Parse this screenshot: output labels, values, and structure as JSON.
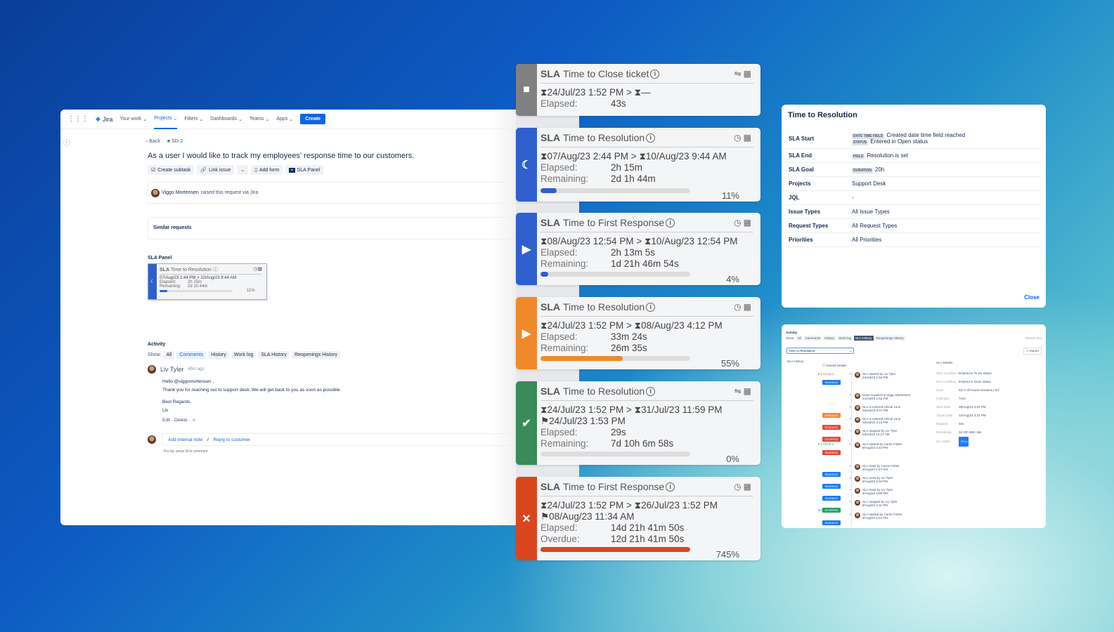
{
  "jira": {
    "nav": {
      "logo": "Jira",
      "items": [
        "Your work",
        "Projects",
        "Filters",
        "Dashboards",
        "Teams",
        "Apps"
      ],
      "active": "Projects",
      "create": "Create"
    },
    "back": "Back",
    "issue_key": "SD-2",
    "title": "As a user I would like to track my employees' response time to our customers.",
    "actions": {
      "subtask": "Create subtask",
      "link": "Link issue",
      "form": "Add form",
      "sla": "SLA Panel"
    },
    "raised": {
      "name": "Viggo Mortensen",
      "text": "raised this request via Jira"
    },
    "similar": "Similar requests",
    "sla_panel": {
      "label": "SLA Panel",
      "sla": "SLA",
      "name": "Time to Resolution",
      "dates": "07/Aug/23 2:44 PM > 10/Aug/23 9:44 AM",
      "elapsed_label": "Elapsed:",
      "elapsed": "2h 15m",
      "remaining_label": "Remaining:",
      "remaining": "2d 1h 44m",
      "percent": "11%",
      "progress": 11
    },
    "activity": {
      "label": "Activity",
      "show": "Show:",
      "tabs": [
        "All",
        "Comments",
        "History",
        "Work log",
        "SLA History",
        "Reopenings History"
      ],
      "selected": "Comments"
    },
    "comment": {
      "author": "Liv Tyler",
      "time": "45m ago",
      "lines": [
        "Hello @viggomortensen ,",
        "Thank you for reaching out to support desk. We will get back to you as soon as possible.",
        "Best Regards,",
        "Liv"
      ],
      "edit": "Edit",
      "delete": "Delete"
    },
    "reply": {
      "internal": "Add internal note",
      "sep": "/",
      "customer": "Reply to customer",
      "tip": "Pro tip: press M to comment"
    }
  },
  "cards": [
    {
      "color": "#808080",
      "icon": "■",
      "icon_name": "stop-icon",
      "sla": "SLA",
      "name": "Time to Close ticket",
      "hicon": "⇋",
      "hicon_name": "handshake-icon",
      "dates": "⧗24/Jul/23 1:52 PM > ⧗—",
      "flag": null,
      "rows": [
        [
          "Elapsed:",
          "43s"
        ]
      ],
      "progress": null,
      "percent": null
    },
    {
      "color": "#2f5fcf",
      "icon": "☾",
      "icon_name": "moon-icon",
      "sla": "SLA",
      "name": "Time to Resolution",
      "hicon": "◷",
      "hicon_name": "clock-icon",
      "dates": "⧗07/Aug/23 2:44 PM > ⧗10/Aug/23 9:44 AM",
      "flag": null,
      "rows": [
        [
          "Elapsed:",
          "2h 15m"
        ],
        [
          "Remaining:",
          "2d 1h 44m"
        ]
      ],
      "progress": 11,
      "percent": "11%",
      "bar": "#2f5fcf"
    },
    {
      "color": "#2f5fcf",
      "icon": "▶",
      "icon_name": "play-icon",
      "sla": "SLA",
      "name": "Time to First Response",
      "hicon": "◷",
      "hicon_name": "clock-icon",
      "dates": "⧗08/Aug/23 12:54 PM > ⧗10/Aug/23 12:54 PM",
      "flag": null,
      "rows": [
        [
          "Elapsed:",
          "2h 13m 5s"
        ],
        [
          "Remaining:",
          "1d 21h 46m 54s"
        ]
      ],
      "progress": 4,
      "percent": "4%",
      "bar": "#2f5fcf"
    },
    {
      "color": "#f0892a",
      "icon": "▶",
      "icon_name": "play-icon",
      "sla": "SLA",
      "name": "Time to Resolution",
      "hicon": "◷",
      "hicon_name": "clock-icon",
      "dates": "⧗24/Jul/23 1:52 PM > ⧗08/Aug/23 4:12 PM",
      "flag": null,
      "rows": [
        [
          "Elapsed:",
          "33m 24s"
        ],
        [
          "Remaining:",
          "26m 35s"
        ]
      ],
      "progress": 55,
      "percent": "55%",
      "bar": "#f0892a"
    },
    {
      "color": "#3a8a5a",
      "icon": "✔",
      "icon_name": "check-icon",
      "sla": "SLA",
      "name": "Time to Resolution",
      "hicon": "⇋",
      "hicon_name": "handshake-icon",
      "dates": "⧗24/Jul/23 1:52 PM > ⧗31/Jul/23 11:59 PM",
      "flag": "⚑24/Jul/23 1:53 PM",
      "rows": [
        [
          "Elapsed:",
          "29s"
        ],
        [
          "Remaining:",
          "7d 10h 6m 58s"
        ]
      ],
      "progress": 0,
      "percent": "0%",
      "bar": "#3a8a5a"
    },
    {
      "color": "#d9461e",
      "icon": "✕",
      "icon_name": "x-icon",
      "sla": "SLA",
      "name": "Time to First Response",
      "hicon": "◷",
      "hicon_name": "clock-icon",
      "dates": "⧗24/Jul/23 1:52 PM > ⧗26/Jul/23 1:52 PM",
      "flag": "⚑08/Aug/23 11:34 AM",
      "rows": [
        [
          "Elapsed:",
          "14d 21h 41m 50s"
        ],
        [
          "Overdue:",
          "12d 21h 41m 50s"
        ]
      ],
      "progress": 100,
      "percent": "745%",
      "bar": "#d9461e"
    }
  ],
  "details": {
    "title": "Time to Resolution",
    "rows": [
      {
        "k": "SLA Start",
        "items": [
          [
            "DATE TIME FIELD",
            "Created date time field reached"
          ],
          [
            "STATUS",
            "Entered in Open status"
          ]
        ]
      },
      {
        "k": "SLA End",
        "items": [
          [
            "FIELD",
            "Resolution is set"
          ]
        ]
      },
      {
        "k": "SLA Goal",
        "items": [
          [
            "DURATION",
            "20h"
          ]
        ]
      },
      {
        "k": "Projects",
        "items": [
          [
            "",
            "Support Desk"
          ]
        ]
      },
      {
        "k": "JQL",
        "items": [
          [
            "",
            "-"
          ]
        ]
      },
      {
        "k": "Issue Types",
        "items": [
          [
            "",
            "All Issue Types"
          ]
        ]
      },
      {
        "k": "Request Types",
        "items": [
          [
            "",
            "All Request Types"
          ]
        ]
      },
      {
        "k": "Priorities",
        "items": [
          [
            "",
            "All Priorities"
          ]
        ]
      }
    ],
    "close": "Close"
  },
  "history": {
    "activity": "Activity",
    "show": "Show:",
    "tabs": [
      "All",
      "Comments",
      "History",
      "Work log",
      "SLA History",
      "Reopenings History"
    ],
    "selected": "SLA History",
    "sort": "Newest first",
    "select": "Time to Resolution",
    "export": "Export",
    "section": "SLA History",
    "overall": "Overall Details",
    "cycles": [
      {
        "label": "CYCLE-1",
        "color": "#e34935"
      },
      {
        "label": "CYCLE-2",
        "color": "#22a06b"
      },
      {
        "label": "CYCLE-3",
        "color": "#0c66e4"
      }
    ],
    "events": [
      {
        "badge": "RUNNING",
        "color": "#1d7afc",
        "text": "SLA started by Liv Tyler",
        "date": "24/Jul/23 1:52 PM"
      },
      {
        "badge": "",
        "color": "",
        "text": "Issue created by Viggo Mortensen",
        "date": "24/Jul/23 1:52 PM"
      },
      {
        "badge": "RUNNING",
        "color": "#f38a3f",
        "text": "SLA is entered critical zone",
        "date": "25/Jul/23 9:07 PM"
      },
      {
        "badge": "RUNNING",
        "color": "#e34935",
        "text": "SLA is entered critical zone",
        "date": "26/Jul/23 2:13 PM"
      },
      {
        "badge": "STOPPED",
        "color": "#e34935",
        "text": "SLA stopped by Liv Tyler",
        "date": "29/Jul/23 10:47 AM"
      },
      {
        "badge": "RUNNING",
        "color": "#e34935",
        "text": "SLA started by Carrie Fisher",
        "date": "8/Aug/23 3:22 PM"
      },
      {
        "badge": "RUNNING",
        "color": "#1d7afc",
        "text": "SLA reset by Carrie Fisher",
        "date": "8/Aug/23 2:47 PM"
      },
      {
        "badge": "RUNNING",
        "color": "#1d7afc",
        "text": "SLA reset by Liv Tyler",
        "date": "8/Aug/23 2:48 PM"
      },
      {
        "badge": "RUNNING",
        "color": "#1d7afc",
        "text": "SLA reset by Liv Tyler",
        "date": "8/Aug/23 3:09 PM"
      },
      {
        "badge": "STOPPED",
        "color": "#22a06b",
        "text": "SLA stopped by Liv Tyler",
        "date": "8/Aug/23 3:11 PM"
      },
      {
        "badge": "RUNNING",
        "color": "#1d7afc",
        "text": "SLA started by Carrie Fisher",
        "date": "8/Aug/23 3:22 PM"
      }
    ],
    "details_title": "SLA Details",
    "details": [
      [
        "Start Condition",
        "Entered in To Do status"
      ],
      [
        "End Condition",
        "Entered in Done status"
      ],
      [
        "Goal",
        "4d /< All issues Duration='4d'"
      ],
      [
        "Calendar",
        "7x24"
      ],
      [
        "Start Date",
        "08/Aug/23 3:22 PM"
      ],
      [
        "Target Date",
        "12/Aug/23 3:22 PM"
      ],
      [
        "Elapsed",
        "40s"
      ],
      [
        "Remaining",
        "3d 23h 59m 19s"
      ],
      [
        "SLA State",
        "STILL"
      ]
    ]
  }
}
